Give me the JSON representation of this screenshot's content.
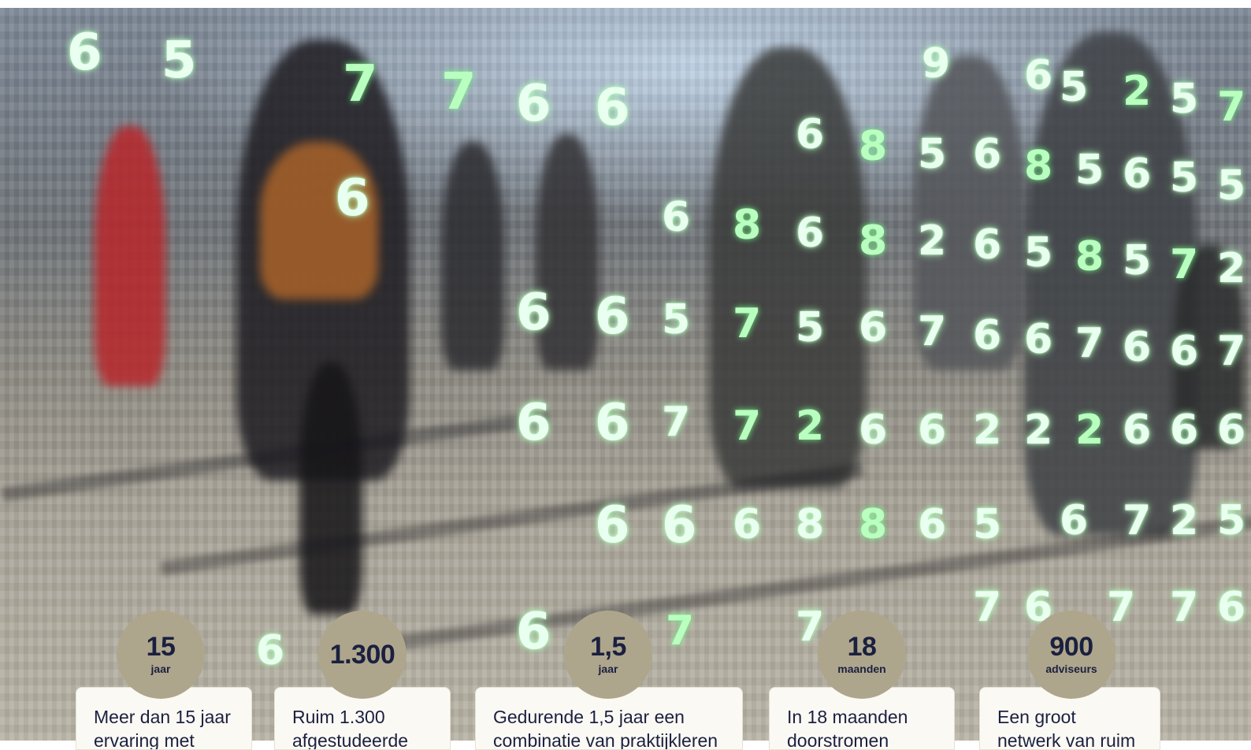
{
  "hero": {
    "background": "binary-code-crowd-image",
    "accent_digit_color": "#b9ffbf"
  },
  "stats": [
    {
      "value": "15",
      "unit": "jaar",
      "text": "Meer dan 15 jaar ervaring met"
    },
    {
      "value": "1.300",
      "unit": "",
      "text": "Ruim 1.300 afgestudeerde"
    },
    {
      "value": "1,5",
      "unit": "jaar",
      "text": "Gedurende 1,5 jaar een combinatie van praktijkleren"
    },
    {
      "value": "18",
      "unit": "maanden",
      "text": "In 18 maanden doorstromen"
    },
    {
      "value": "900",
      "unit": "adviseurs",
      "text": "Een groot netwerk van ruim"
    }
  ],
  "colors": {
    "circle": "#aea68c",
    "card": "#fbf9f4",
    "text": "#1b2040"
  }
}
